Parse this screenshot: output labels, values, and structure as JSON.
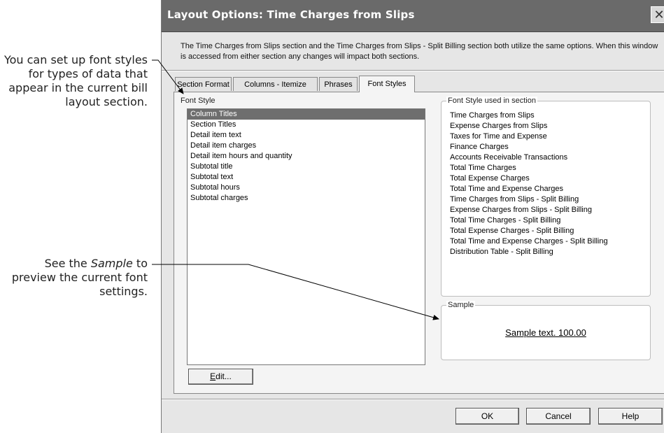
{
  "callouts": {
    "font_styles": "You can set up font styles for types of data that appear in the current bill layout section.",
    "sample_prefix": "See the ",
    "sample_em": "Sample",
    "sample_suffix": " to preview the current font settings."
  },
  "window": {
    "title": "Layout Options: Time Charges from Slips",
    "close_glyph": "✕",
    "description": "The Time Charges from Slips section and the Time Charges from Slips - Split Billing section both utilize the same options. When this window is accessed from either section any changes will impact both sections."
  },
  "tabs": [
    {
      "label": "Section Format"
    },
    {
      "label": "Columns - Itemize"
    },
    {
      "label": "Phrases"
    },
    {
      "label": "Font Styles"
    }
  ],
  "font_style": {
    "group_label": "Font Style",
    "items": [
      "Column Titles",
      "Section Titles",
      "Detail item text",
      "Detail item charges",
      "Detail item hours and quantity",
      "Subtotal title",
      "Subtotal text",
      "Subtotal hours",
      "Subtotal charges"
    ],
    "selected": "Column Titles"
  },
  "used_in_section": {
    "group_label": "Font Style used in section",
    "items": [
      "Time Charges from Slips",
      "Expense Charges from Slips",
      "Taxes for Time and Expense",
      "Finance Charges",
      "Accounts Receivable Transactions",
      "Total Time Charges",
      "Total Expense Charges",
      "Total Time and Expense Charges",
      "Time Charges from Slips - Split Billing",
      "Expense Charges from Slips - Split Billing",
      "Total Time Charges - Split Billing",
      "Total Expense Charges - Split Billing",
      "Total Time and Expense Charges - Split Billing",
      "Distribution Table - Split Billing"
    ]
  },
  "sample": {
    "group_label": "Sample",
    "text": "Sample text. 100.00"
  },
  "buttons": {
    "edit_mnemonic": "E",
    "edit_rest": "dit...",
    "ok": "OK",
    "cancel": "Cancel",
    "help": "Help"
  }
}
